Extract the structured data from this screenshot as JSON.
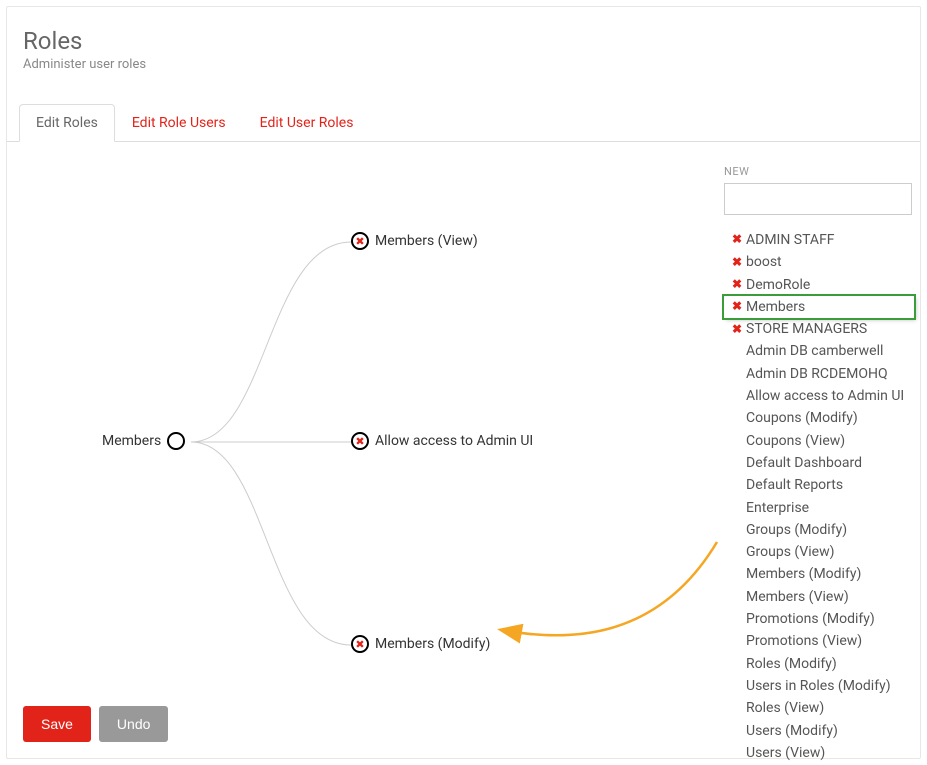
{
  "header": {
    "title": "Roles",
    "subtitle": "Administer user roles"
  },
  "tabs": {
    "edit_roles": "Edit Roles",
    "edit_role_users": "Edit Role Users",
    "edit_user_roles": "Edit User Roles"
  },
  "tree": {
    "root": "Members",
    "children": [
      "Members (View)",
      "Allow access to Admin UI",
      "Members (Modify)"
    ]
  },
  "side": {
    "new_label": "NEW",
    "new_value": "",
    "items": [
      {
        "label": "ADMIN STAFF",
        "deletable": true,
        "highlight": false
      },
      {
        "label": "boost",
        "deletable": true,
        "highlight": false
      },
      {
        "label": "DemoRole",
        "deletable": true,
        "highlight": false
      },
      {
        "label": "Members",
        "deletable": true,
        "highlight": true
      },
      {
        "label": "STORE MANAGERS",
        "deletable": true,
        "highlight": false
      },
      {
        "label": "Admin DB camberwell",
        "deletable": false,
        "highlight": false
      },
      {
        "label": "Admin DB RCDEMOHQ",
        "deletable": false,
        "highlight": false
      },
      {
        "label": "Allow access to Admin UI",
        "deletable": false,
        "highlight": false
      },
      {
        "label": "Coupons (Modify)",
        "deletable": false,
        "highlight": false
      },
      {
        "label": "Coupons (View)",
        "deletable": false,
        "highlight": false
      },
      {
        "label": "Default Dashboard",
        "deletable": false,
        "highlight": false
      },
      {
        "label": "Default Reports",
        "deletable": false,
        "highlight": false
      },
      {
        "label": "Enterprise",
        "deletable": false,
        "highlight": false
      },
      {
        "label": "Groups (Modify)",
        "deletable": false,
        "highlight": false
      },
      {
        "label": "Groups (View)",
        "deletable": false,
        "highlight": false
      },
      {
        "label": "Members (Modify)",
        "deletable": false,
        "highlight": false
      },
      {
        "label": "Members (View)",
        "deletable": false,
        "highlight": false
      },
      {
        "label": "Promotions (Modify)",
        "deletable": false,
        "highlight": false
      },
      {
        "label": "Promotions (View)",
        "deletable": false,
        "highlight": false
      },
      {
        "label": "Roles (Modify)",
        "deletable": false,
        "highlight": false
      },
      {
        "label": "Users in Roles (Modify)",
        "deletable": false,
        "highlight": false
      },
      {
        "label": "Roles (View)",
        "deletable": false,
        "highlight": false
      },
      {
        "label": "Users (Modify)",
        "deletable": false,
        "highlight": false
      },
      {
        "label": "Users (View)",
        "deletable": false,
        "highlight": false
      }
    ]
  },
  "footer": {
    "save": "Save",
    "undo": "Undo"
  }
}
